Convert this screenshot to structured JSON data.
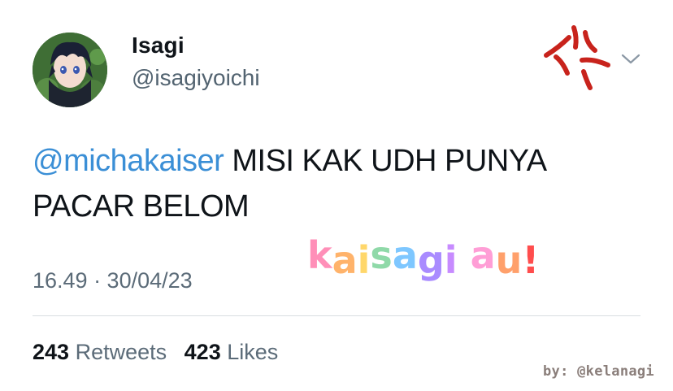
{
  "author": {
    "display_name": "Isagi",
    "handle": "@isagiyoichi"
  },
  "tweet": {
    "mention": "@michakaiser",
    "text": " MISI KAK UDH PUNYA PACAR BELOM",
    "timestamp": "16.49 · 30/04/23"
  },
  "stats": {
    "retweets_count": "243",
    "retweets_label": "Retweets",
    "likes_count": "423",
    "likes_label": "Likes"
  },
  "overlay": {
    "doodle_text": "kaisagi au!",
    "credit": "by: @kelanagi"
  },
  "colors": {
    "mention": "#3b8fd6",
    "secondary_text": "#5b6b78",
    "anger_mark": "#c8231c"
  },
  "icons": {
    "menu": "chevron-down-icon",
    "anger": "anger-mark-icon"
  }
}
